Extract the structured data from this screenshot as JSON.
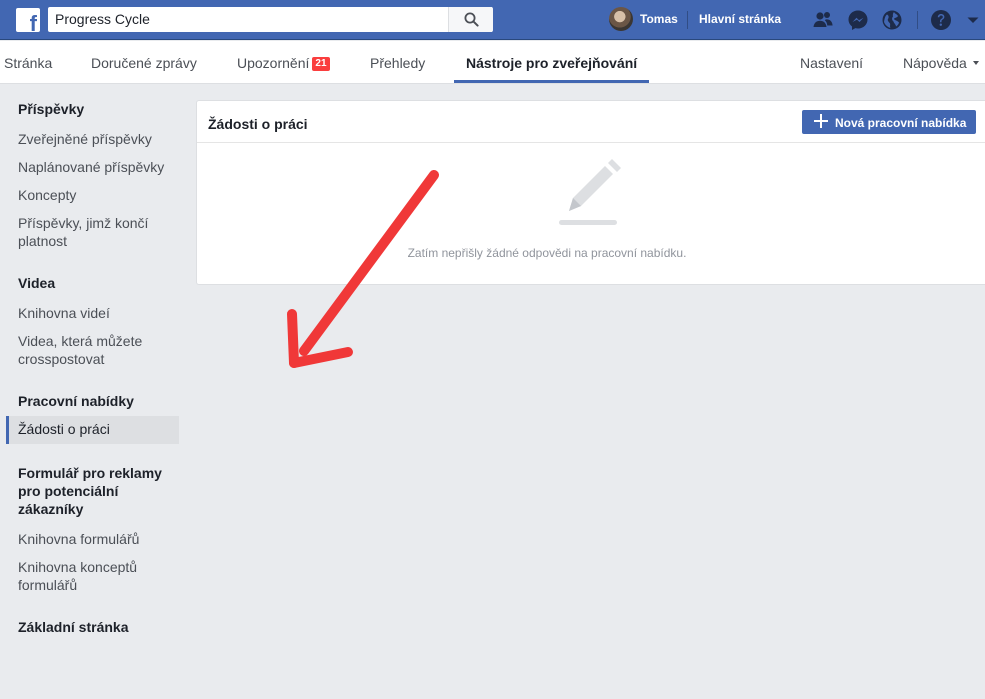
{
  "topbar": {
    "search_value": "Progress Cycle",
    "user_name": "Tomas",
    "home_link": "Hlavní stránka",
    "icons": [
      "facebook-logo",
      "search-icon",
      "friends-icon",
      "messenger-icon",
      "globe-icon",
      "help-icon",
      "dropdown-caret-icon"
    ]
  },
  "pagenav": {
    "tabs": [
      {
        "label": "Stránka"
      },
      {
        "label": "Doručené zprávy"
      },
      {
        "label": "Upozornění",
        "badge": "21"
      },
      {
        "label": "Přehledy"
      },
      {
        "label": "Nástroje pro zveřejňování",
        "active": true
      }
    ],
    "settings": "Nastavení",
    "help": "Nápověda"
  },
  "sidebar": {
    "sections": [
      {
        "title": "Příspěvky",
        "items": [
          "Zveřejněné příspěvky",
          "Naplánované příspěvky",
          "Koncepty",
          "Příspěvky, jimž končí platnost"
        ]
      },
      {
        "title": "Videa",
        "items": [
          "Knihovna videí",
          "Videa, která můžete crosspostovat"
        ]
      },
      {
        "title": "Pracovní nabídky",
        "items": [
          "Žádosti o práci"
        ]
      },
      {
        "title": "Formulář pro reklamy pro potenciální zákazníky",
        "items": [
          "Knihovna formulářů",
          "Knihovna konceptů formulářů"
        ]
      },
      {
        "title": "Základní stránka",
        "items": []
      }
    ],
    "active_item": "Žádosti o práci"
  },
  "main": {
    "title": "Žádosti o práci",
    "new_button": "Nová pracovní nabídka",
    "empty_text": "Zatím nepřišly žádné odpovědi na pracovní nabídku."
  },
  "colors": {
    "brand": "#4267b2",
    "badge": "#fa3e3e",
    "annotation_arrow": "#f03838"
  }
}
